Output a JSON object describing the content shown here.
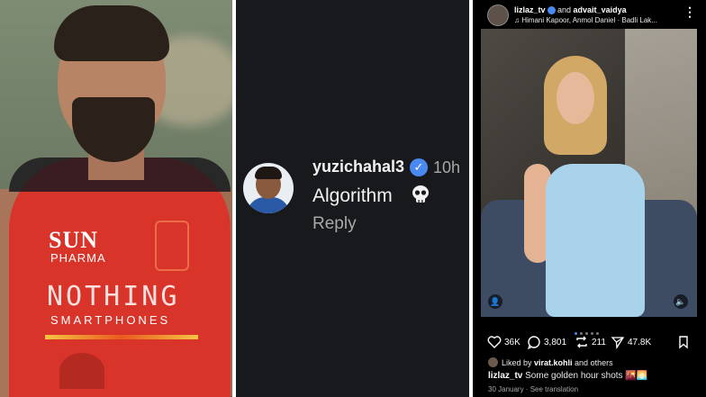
{
  "panel_comment": {
    "username": "yuzichahal3",
    "time": "10h",
    "text": "Algorithm",
    "emoji": "skull-emoji",
    "reply_label": "Reply"
  },
  "panel_post": {
    "users_first": "lizlaz_tv",
    "users_and": " and ",
    "users_second": "advait_vaidya",
    "music_line": "♫ Himani Kapoor, Anmol Daniel · Badli Lak...",
    "likes": "36K",
    "comments": "3,801",
    "reposts": "211",
    "shares": "47.8K",
    "liked_by_prefix": "Liked by ",
    "liked_by_user": "virat.kohli",
    "liked_by_suffix": " and others",
    "caption_user": "lizlaz_tv",
    "caption_text": " Some golden hour shots 🌇🌅",
    "date_line": "30 January · See translation"
  },
  "panel_photo": {
    "jersey_brand_1": "SUN",
    "jersey_brand_2": "PHARMA",
    "jersey_brand_3": "NOTHING",
    "jersey_brand_4": "SMARTPHONES"
  },
  "colors": {
    "verified_blue": "#4a8af0",
    "jersey_red": "#d8342a",
    "comment_bg": "#18191c"
  }
}
